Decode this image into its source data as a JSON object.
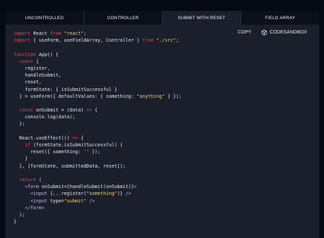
{
  "tabs": [
    {
      "label": "UNCONTROLLED",
      "active": false
    },
    {
      "label": "CONTROLLER",
      "active": false
    },
    {
      "label": "SUBMIT WITH RESET",
      "active": true
    },
    {
      "label": "FIELD ARRAY",
      "active": false
    }
  ],
  "actions": {
    "copy_label": "COPY",
    "codesandbox_label": "CODESANDBOX"
  },
  "code_lines": [
    [
      [
        "k",
        "import"
      ],
      [
        "t",
        " React "
      ],
      [
        "k",
        "from"
      ],
      [
        "t",
        " "
      ],
      [
        "s",
        "\"react\""
      ],
      [
        "t",
        ";"
      ]
    ],
    [
      [
        "k",
        "import"
      ],
      [
        "t",
        " { useForm, useFieldArray, Controller } "
      ],
      [
        "k",
        "from"
      ],
      [
        "t",
        " "
      ],
      [
        "s",
        "\"./src\""
      ],
      [
        "t",
        ";"
      ]
    ],
    [
      [
        "t",
        ""
      ]
    ],
    [
      [
        "k",
        "function"
      ],
      [
        "t",
        " App() {"
      ]
    ],
    [
      [
        "t",
        "  "
      ],
      [
        "k",
        "const"
      ],
      [
        "t",
        " {"
      ]
    ],
    [
      [
        "t",
        "    register,"
      ]
    ],
    [
      [
        "t",
        "    handleSubmit,"
      ]
    ],
    [
      [
        "t",
        "    reset,"
      ]
    ],
    [
      [
        "t",
        "    formState: { isSubmitSuccessful }"
      ]
    ],
    [
      [
        "t",
        "  } = useForm({ defaultValues: { something: "
      ],
      [
        "s",
        "\"anything\""
      ],
      [
        "t",
        " } });"
      ]
    ],
    [
      [
        "t",
        ""
      ]
    ],
    [
      [
        "t",
        "  "
      ],
      [
        "k",
        "const"
      ],
      [
        "t",
        " onSubmit = (data) "
      ],
      [
        "k",
        "=>"
      ],
      [
        "t",
        " {"
      ]
    ],
    [
      [
        "t",
        "    console.log(data);"
      ]
    ],
    [
      [
        "t",
        "  };"
      ]
    ],
    [
      [
        "t",
        ""
      ]
    ],
    [
      [
        "t",
        "  React.useEffect(() "
      ],
      [
        "k",
        "=>"
      ],
      [
        "t",
        " {"
      ]
    ],
    [
      [
        "t",
        "    "
      ],
      [
        "k",
        "if"
      ],
      [
        "t",
        " (formState.isSubmitSuccessful) {"
      ]
    ],
    [
      [
        "t",
        "      reset({ something: "
      ],
      [
        "s",
        "''"
      ],
      [
        "t",
        " });"
      ]
    ],
    [
      [
        "t",
        "    }"
      ]
    ],
    [
      [
        "t",
        "  }, [formState, submittedData, reset]);"
      ]
    ],
    [
      [
        "t",
        ""
      ]
    ],
    [
      [
        "t",
        "  "
      ],
      [
        "k",
        "return"
      ],
      [
        "t",
        " ("
      ]
    ],
    [
      [
        "t",
        "    "
      ],
      [
        "p",
        "<form"
      ],
      [
        "t",
        " onSubmit={handleSubmit(onSubmit)}"
      ],
      [
        "p",
        ">"
      ]
    ],
    [
      [
        "t",
        "      "
      ],
      [
        "p",
        "<input"
      ],
      [
        "t",
        " {...register("
      ],
      [
        "s",
        "\"something\""
      ],
      [
        "t",
        ")} "
      ],
      [
        "p",
        "/>"
      ]
    ],
    [
      [
        "t",
        "      "
      ],
      [
        "p",
        "<input"
      ],
      [
        "t",
        " type="
      ],
      [
        "s",
        "\"submit\""
      ],
      [
        "t",
        " "
      ],
      [
        "p",
        "/>"
      ]
    ],
    [
      [
        "t",
        "    "
      ],
      [
        "p",
        "</form>"
      ]
    ],
    [
      [
        "t",
        "  );"
      ]
    ],
    [
      [
        "t",
        "}"
      ]
    ]
  ]
}
